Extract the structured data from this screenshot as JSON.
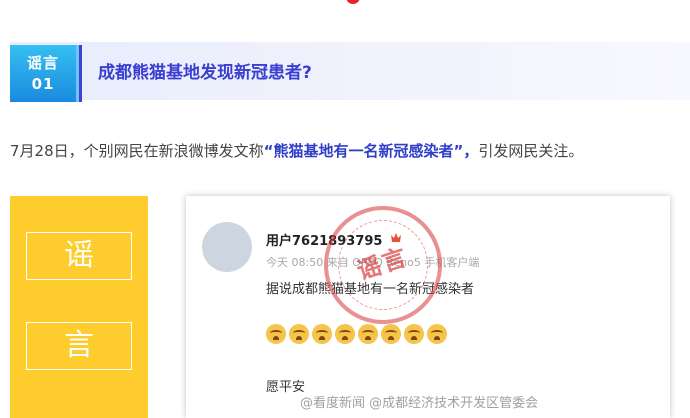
{
  "banner": {
    "tag_line1": "谣言",
    "tag_line2": "01",
    "title": "成都熊猫基地发现新冠患者?"
  },
  "paragraph": {
    "before": "7月28日，个别网民在新浪微博发文称",
    "highlight": "“熊猫基地有一名新冠感染者”，",
    "after": "引发网民关注。"
  },
  "rumor_panel": {
    "char1": "谣",
    "char2": "言"
  },
  "post": {
    "username": "用户7621893795",
    "meta": "今天 08:50 来自 OPPO Reno5 手机客户端",
    "text": "据说成都熊猫基地有一名新冠感染者",
    "emoji_count_label": "[泪]",
    "sign_off": "愿平安",
    "stamp_text": "谣言"
  },
  "watermark": "@看度新闻  @成都经济技术开发区管委会",
  "colors": {
    "accent_blue": "#3a3fd1",
    "panel_yellow": "#ffcc2e",
    "stamp_red": "#d73737"
  }
}
